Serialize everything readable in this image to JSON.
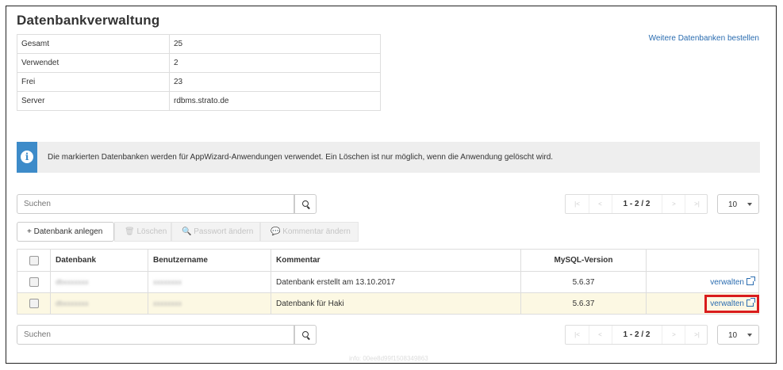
{
  "page": {
    "title": "Datenbankverwaltung",
    "order_link": "Weitere Datenbanken bestellen"
  },
  "stats": [
    {
      "label": "Gesamt",
      "value": "25"
    },
    {
      "label": "Verwendet",
      "value": "2"
    },
    {
      "label": "Frei",
      "value": "23"
    },
    {
      "label": "Server",
      "value": "rdbms.strato.de"
    }
  ],
  "info": {
    "icon": "info-icon",
    "text": "Die markierten Datenbanken werden für AppWizard-Anwendungen verwendet. Ein Löschen ist nur möglich, wenn die Anwendung gelöscht wird."
  },
  "search": {
    "placeholder": "Suchen",
    "icon": "search-icon"
  },
  "pager": {
    "first": "first-page-icon",
    "prev": "prev-page-icon",
    "next": "next-page-icon",
    "last": "last-page-icon",
    "info": "1 - 2 / 2",
    "per_page": "10"
  },
  "toolbar": {
    "add": "+ Datenbank anlegen",
    "delete": "🗑 Löschen",
    "password": "🔍 Passwort ändern",
    "comment": "💬 Kommentar ändern"
  },
  "table": {
    "headers": [
      "Datenbank",
      "Benutzername",
      "Kommentar",
      "MySQL-Version"
    ],
    "rows": [
      {
        "database": "dbxxxxxxx",
        "user": "xxxxxxxx",
        "comment": "Datenbank erstellt am 13.10.2017",
        "version": "5.6.37",
        "action": "verwalten"
      },
      {
        "database": "dbxxxxxxx",
        "user": "xxxxxxxx",
        "comment": "Datenbank für Haki",
        "version": "5.6.37",
        "action": "verwalten"
      }
    ]
  },
  "footer": {
    "id_text": "info: 00ee8d99f1508349863"
  },
  "colors": {
    "link": "#2a6cb0",
    "info_accent": "#3d8bc9",
    "highlight_row": "#fcf8e3",
    "highlight_border": "#d91c1c"
  }
}
